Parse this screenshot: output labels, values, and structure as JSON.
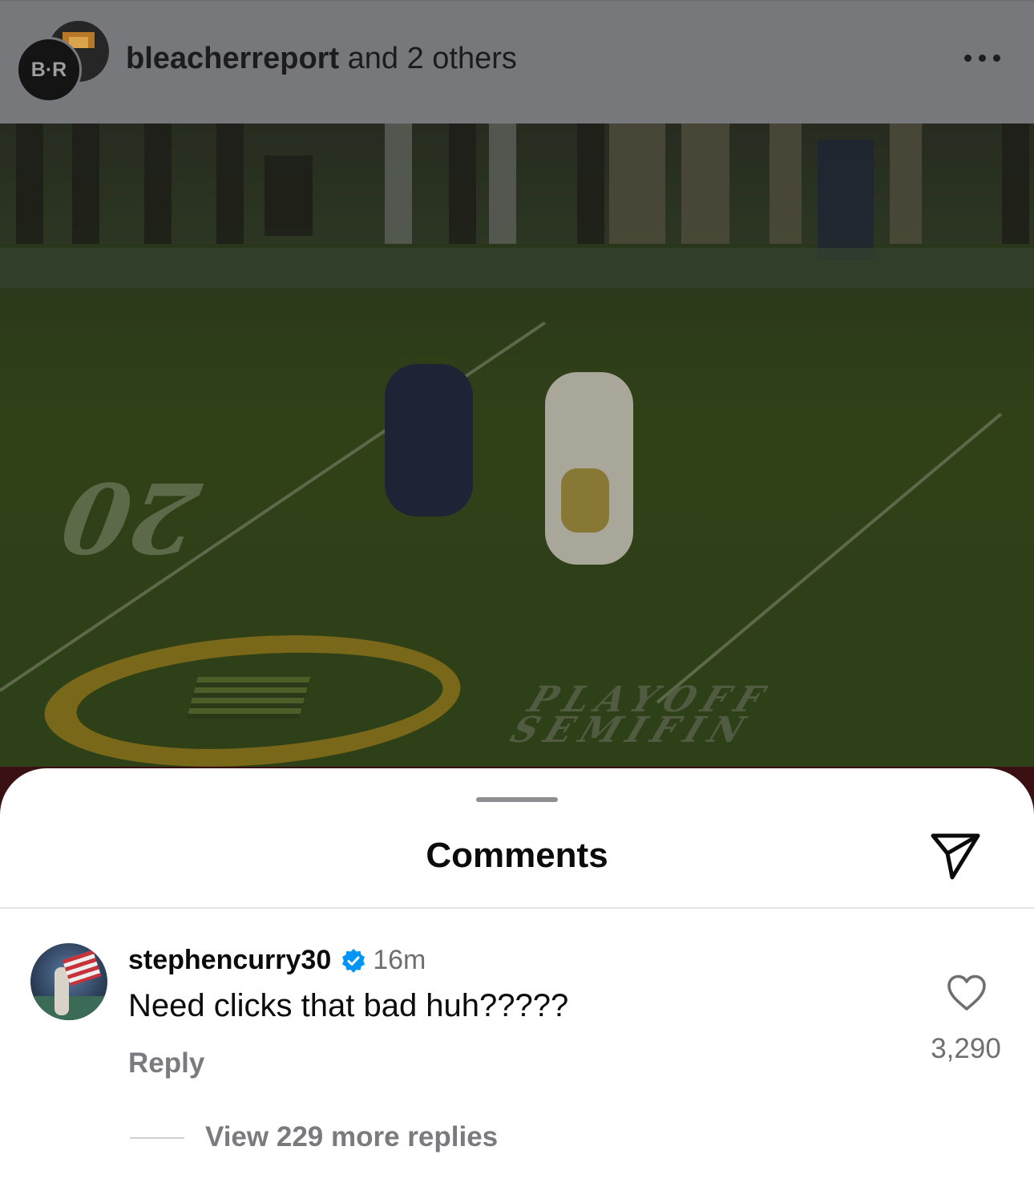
{
  "post": {
    "author": "bleacherreport",
    "coauthors_text": " and 2 others",
    "avatar_monogram": "B·R",
    "menu_icon": "more-horizontal-icon"
  },
  "video": {
    "field_number": "20",
    "field_text_line1": "PLAYOFF",
    "field_text_line2": "SEMIFIN"
  },
  "comments_sheet": {
    "title": "Comments",
    "share_icon": "send-icon"
  },
  "comment": {
    "username": "stephencurry30",
    "verified": true,
    "verified_color": "#0095f6",
    "time": "16m",
    "text": "Need clicks that bad huh?????",
    "reply_label": "Reply",
    "like_icon": "heart-outline-icon",
    "like_count": "3,290",
    "view_replies_label": "View 229 more replies"
  }
}
